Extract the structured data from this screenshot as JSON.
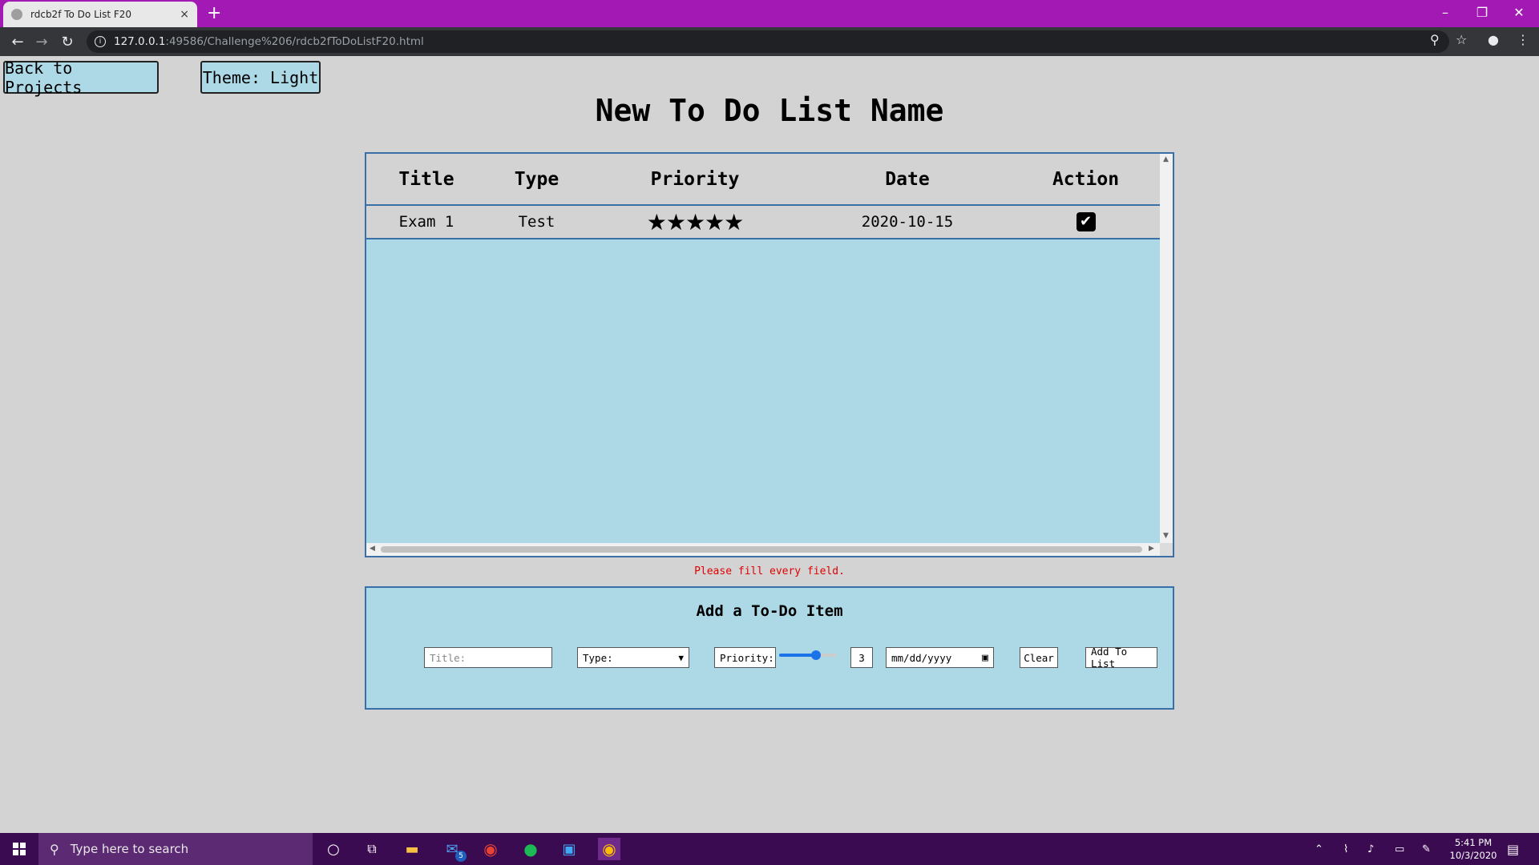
{
  "browser": {
    "tab_title": "rdcb2f To Do List F20",
    "tab_close": "×",
    "new_tab": "+",
    "url_host": "127.0.0.1",
    "url_rest": ":49586/Challenge%206/rdcb2fToDoListF20.html",
    "window_controls": {
      "minimize": "–",
      "restore": "❐",
      "close": "✕"
    }
  },
  "page": {
    "back_button": "Back to Projects",
    "theme_button": "Theme: Light",
    "title": "New To Do List Name",
    "error_message": "Please fill every field."
  },
  "table": {
    "headers": [
      "Title",
      "Type",
      "Priority",
      "Date",
      "Action"
    ],
    "rows": [
      {
        "title": "Exam 1",
        "type": "Test",
        "priority": "★★★★★",
        "priority_value": 5,
        "date": "2020-10-15",
        "done": true
      }
    ]
  },
  "form": {
    "heading": "Add a To-Do Item",
    "title_placeholder": "Title:",
    "type_placeholder": "Type:",
    "priority_label": "Priority:",
    "priority_value": "3",
    "priority_slider_fraction": 0.6,
    "date_placeholder": "mm/dd/yyyy",
    "clear_button": "Clear",
    "add_button": "Add To List"
  },
  "taskbar": {
    "search_placeholder": "Type here to search",
    "mail_badge": "5",
    "time": "5:41 PM",
    "date": "10/3/2020"
  },
  "colors": {
    "browser_frame": "#a21ab3",
    "page_background": "#d3d3d3",
    "panel_background": "#add8e6",
    "error": "#e00000",
    "taskbar": "#3b0b52"
  }
}
